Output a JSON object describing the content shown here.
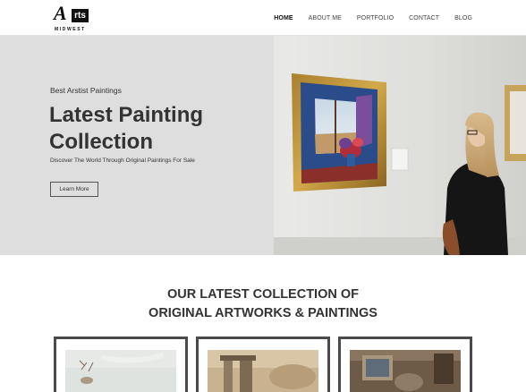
{
  "header": {
    "logo_mark": "A",
    "logo_box": "rts",
    "logo_sub": "MIDWEST",
    "nav": [
      {
        "label": "HOME",
        "active": true
      },
      {
        "label": "ABOUT ME",
        "active": false
      },
      {
        "label": "PORTFOLIO",
        "active": false
      },
      {
        "label": "CONTACT",
        "active": false
      },
      {
        "label": "BLOG",
        "active": false
      }
    ]
  },
  "hero": {
    "eyebrow": "Best Arstist Paintings",
    "title_line1": "Latest Painting",
    "title_line2": "Collection",
    "subtitle": "Discover The World Through Original Paintings For Sale",
    "button_label": "Learn More"
  },
  "collection": {
    "title_line1": "OUR LATEST COLLECTION OF",
    "title_line2": "ORIGINAL ARTWORKS & PAINTINGS"
  },
  "colors": {
    "text": "#333333",
    "hero_bg": "#dedede",
    "card_border": "#4a4a4a"
  }
}
